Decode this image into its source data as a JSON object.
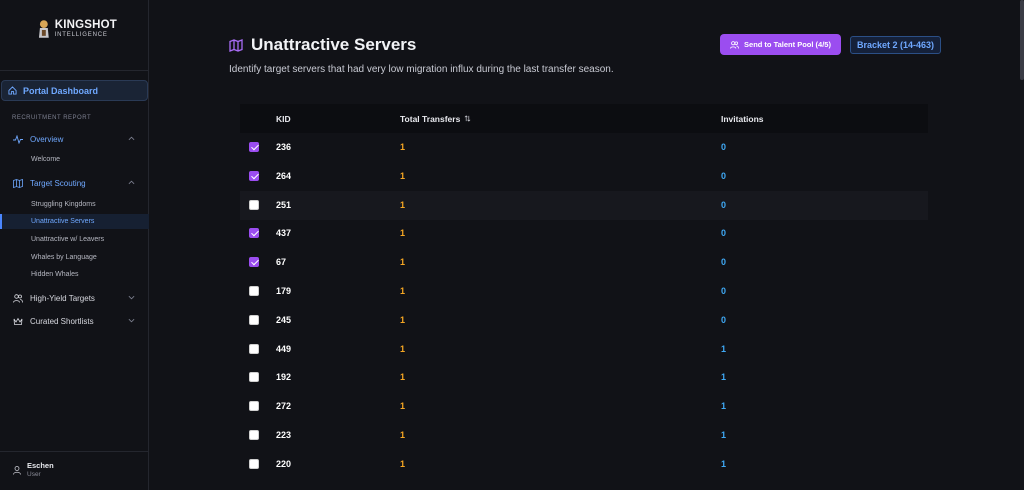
{
  "brand": {
    "title": "KINGSHOT",
    "subtitle": "INTELLIGENCE"
  },
  "sidebar": {
    "portal_label": "Portal Dashboard",
    "section_label": "RECRUITMENT REPORT",
    "groups": [
      {
        "label": "Overview",
        "icon": "activity-icon",
        "expanded": true,
        "items": [
          {
            "label": "Welcome"
          }
        ]
      },
      {
        "label": "Target Scouting",
        "icon": "map-icon",
        "expanded": true,
        "items": [
          {
            "label": "Struggling Kingdoms"
          },
          {
            "label": "Unattractive Servers",
            "selected": true
          },
          {
            "label": "Unattractive w/ Leavers"
          },
          {
            "label": "Whales by Language"
          },
          {
            "label": "Hidden Whales"
          }
        ]
      },
      {
        "label": "High-Yield Targets",
        "icon": "users-icon",
        "expanded": false
      },
      {
        "label": "Curated Shortlists",
        "icon": "crown-icon",
        "expanded": false
      }
    ],
    "user": {
      "name": "Eschen",
      "role": "User"
    }
  },
  "header": {
    "title": "Unattractive Servers",
    "description": "Identify target servers that had very low migration influx during the last transfer season.",
    "send_button": "Send to Talent Pool (4/5)",
    "bracket": "Bracket 2 (14-463)"
  },
  "table": {
    "columns": {
      "kid": "KID",
      "total_transfers": "Total Transfers",
      "invitations": "Invitations"
    },
    "rows": [
      {
        "checked": true,
        "kid": "236",
        "total": "1",
        "inv": "0"
      },
      {
        "checked": true,
        "kid": "264",
        "total": "1",
        "inv": "0"
      },
      {
        "checked": false,
        "kid": "251",
        "total": "1",
        "inv": "0"
      },
      {
        "checked": true,
        "kid": "437",
        "total": "1",
        "inv": "0"
      },
      {
        "checked": true,
        "kid": "67",
        "total": "1",
        "inv": "0"
      },
      {
        "checked": false,
        "kid": "179",
        "total": "1",
        "inv": "0"
      },
      {
        "checked": false,
        "kid": "245",
        "total": "1",
        "inv": "0"
      },
      {
        "checked": false,
        "kid": "449",
        "total": "1",
        "inv": "1"
      },
      {
        "checked": false,
        "kid": "192",
        "total": "1",
        "inv": "1"
      },
      {
        "checked": false,
        "kid": "272",
        "total": "1",
        "inv": "1"
      },
      {
        "checked": false,
        "kid": "223",
        "total": "1",
        "inv": "1"
      },
      {
        "checked": false,
        "kid": "220",
        "total": "1",
        "inv": "1"
      }
    ]
  },
  "colors": {
    "accent_purple": "#9b4df0",
    "link_blue": "#6fa8ff",
    "transfer_orange": "#f5a623",
    "invitation_blue": "#3fa9f5"
  }
}
